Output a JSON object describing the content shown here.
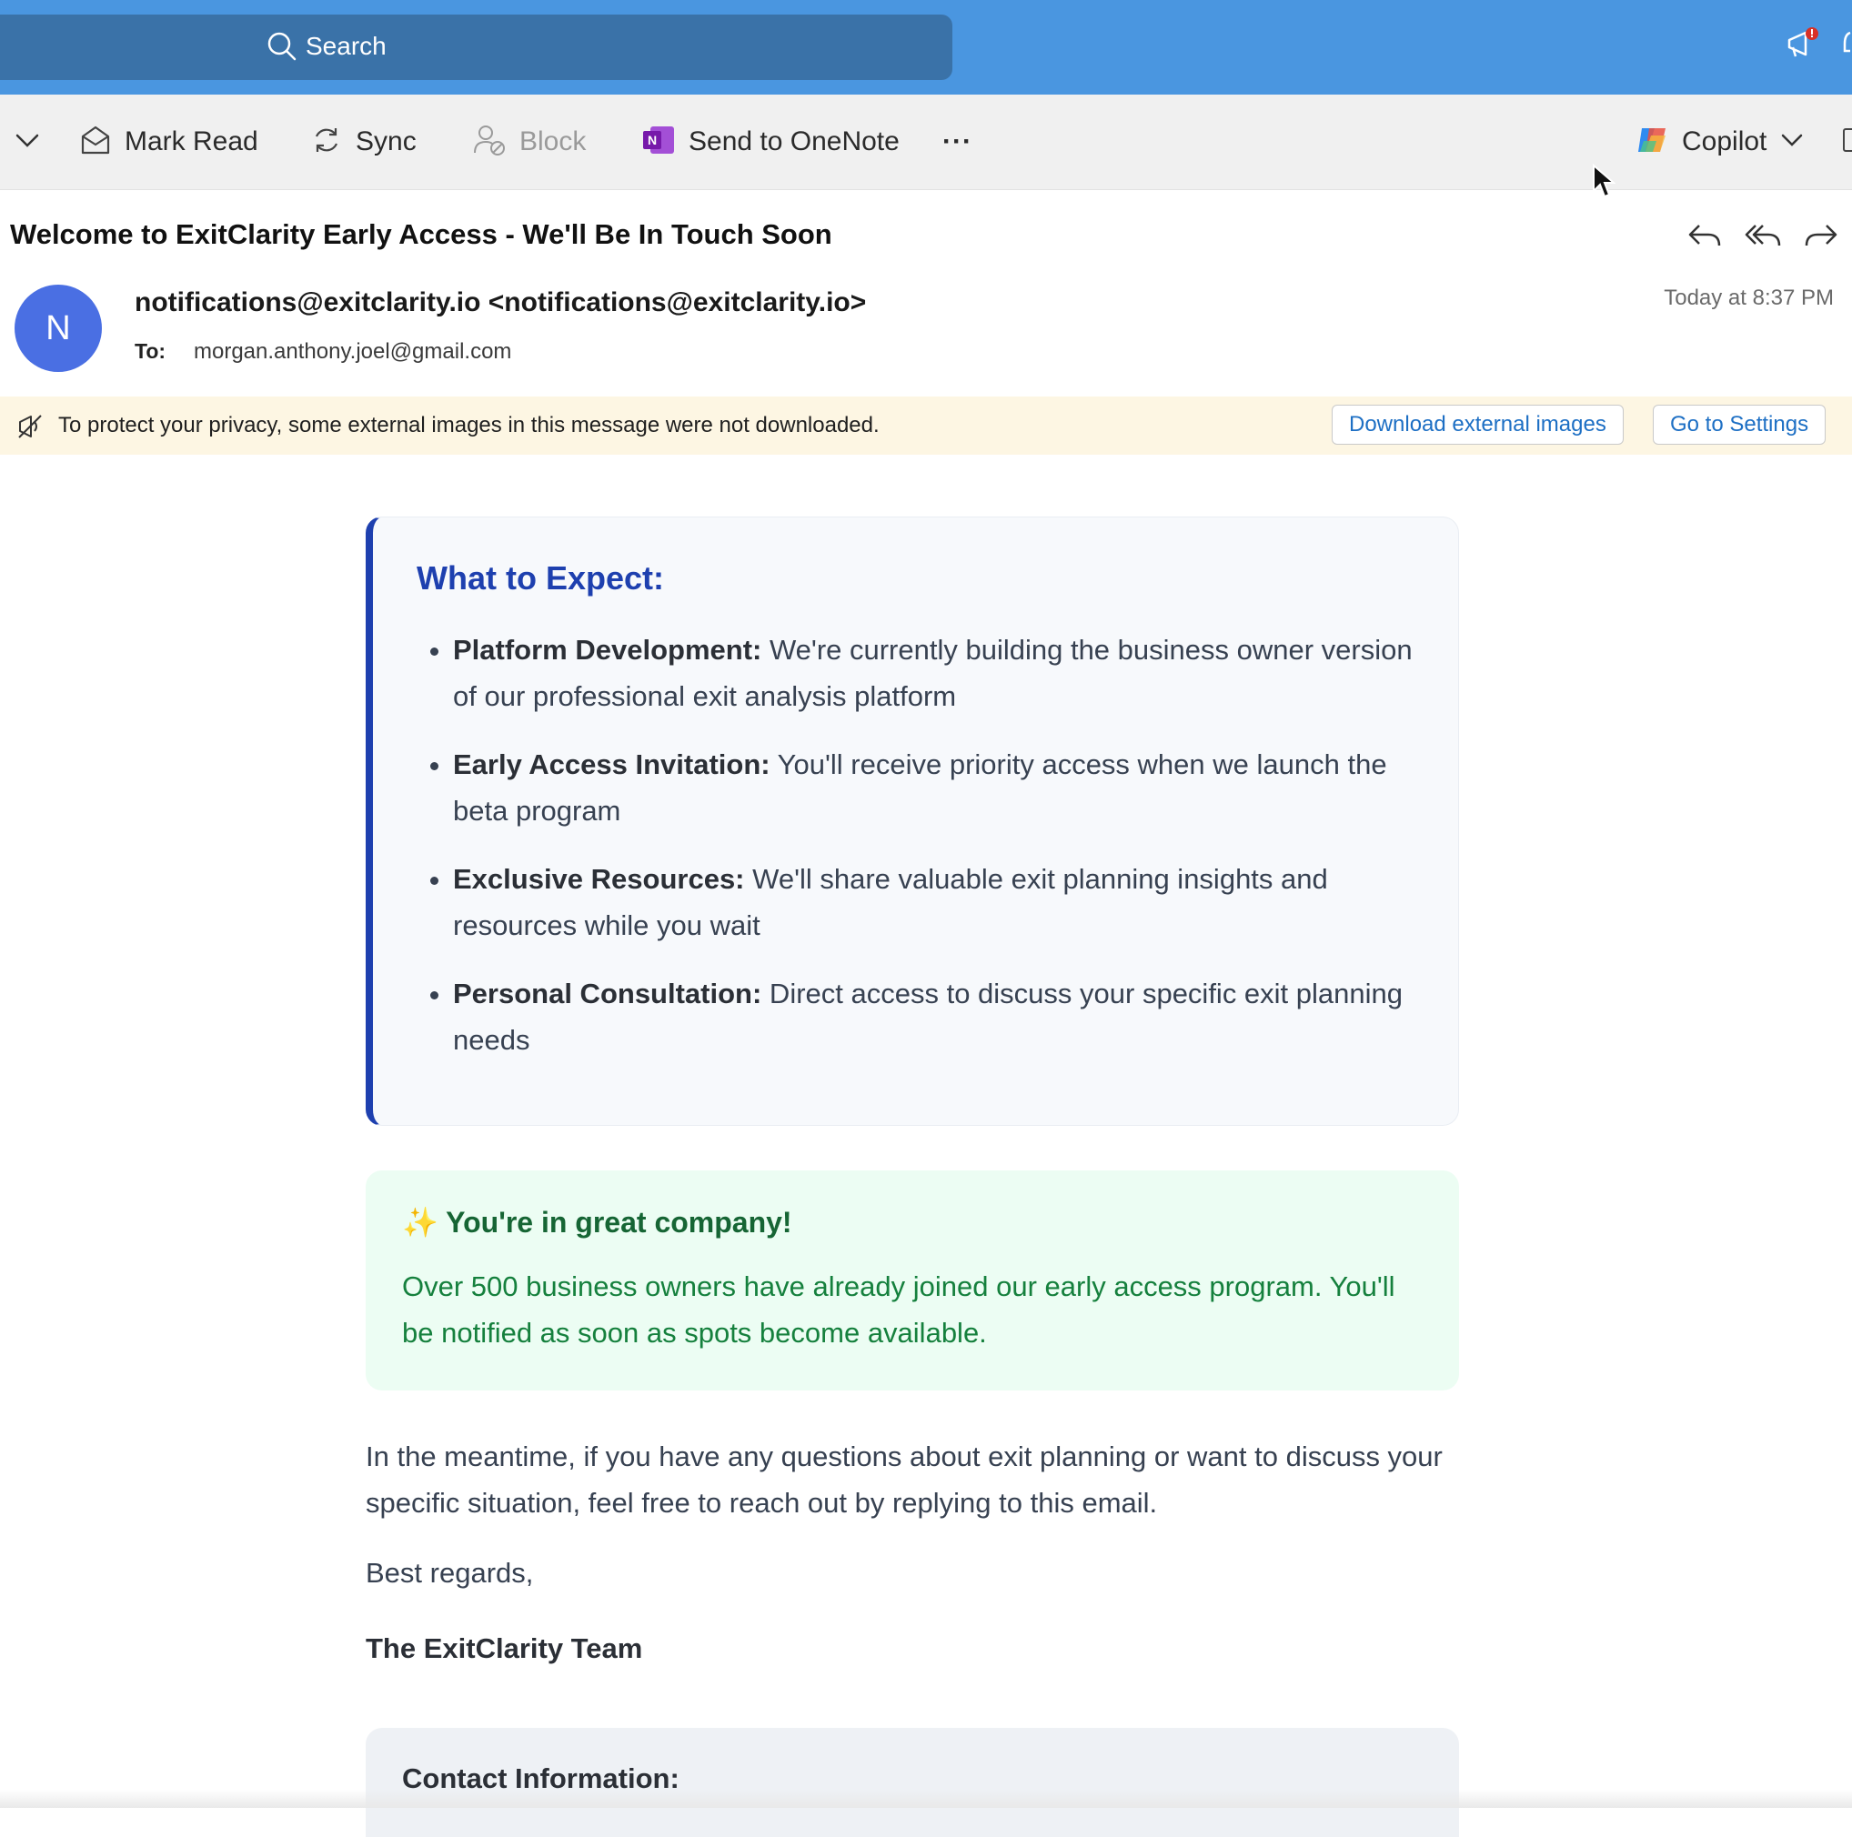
{
  "search": {
    "placeholder": "Search"
  },
  "toolbar": {
    "mark_read": "Mark Read",
    "sync": "Sync",
    "block": "Block",
    "send_onenote": "Send to OneNote",
    "more": "···",
    "copilot": "Copilot"
  },
  "message": {
    "subject": "Welcome to ExitClarity Early Access - We'll Be In Touch Soon",
    "avatar_initial": "N",
    "sender": "notifications@exitclarity.io <notifications@exitclarity.io>",
    "to_label": "To:",
    "to_value": "morgan.anthony.joel@gmail.com",
    "date": "Today at 8:37 PM"
  },
  "banner": {
    "text": "To protect your privacy, some external images in this message were not downloaded.",
    "download_btn": "Download external images",
    "settings_btn": "Go to Settings"
  },
  "body": {
    "expect_title": "What to Expect:",
    "items": [
      {
        "label": "Platform Development:",
        "text": " We're currently building the business owner version of our professional exit analysis platform"
      },
      {
        "label": "Early Access Invitation:",
        "text": " You'll receive priority access when we launch the beta program"
      },
      {
        "label": "Exclusive Resources:",
        "text": " We'll share valuable exit planning insights and resources while you wait"
      },
      {
        "label": "Personal Consultation:",
        "text": " Direct access to discuss your specific exit planning needs"
      }
    ],
    "company_title": "✨ You're in great company!",
    "company_text": "Over 500 business owners have already joined our early access program. You'll be notified as soon as spots become available.",
    "meantime": "In the meantime, if you have any questions about exit planning or want to discuss your specific situation, feel free to reach out by replying to this email.",
    "regards": "Best regards,",
    "team": "The ExitClarity Team",
    "contact_title": "Contact Information:"
  },
  "colors": {
    "header_blue": "#4a96e0",
    "search_blue": "#3a72a8",
    "accent_navy": "#1e40af",
    "green_text": "#15803d",
    "avatar": "#4a6fe3"
  }
}
